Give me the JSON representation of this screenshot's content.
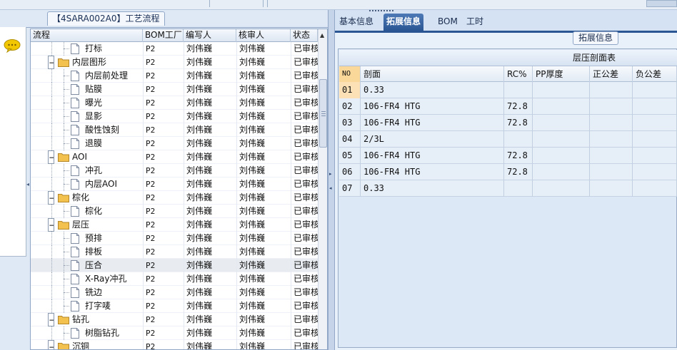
{
  "left": {
    "pane_title": "【4SARA002A0】工艺流程",
    "columns": [
      "流程",
      "BOM工厂",
      "编写人",
      "核审人",
      "状态"
    ],
    "rows": [
      {
        "name": "打标",
        "level": 2,
        "kind": "doc",
        "bom": "P2",
        "writer": "刘伟巍",
        "reviewer": "刘伟巍",
        "status": "已审核"
      },
      {
        "name": "内层图形",
        "level": 1,
        "kind": "folder",
        "bom": "P2",
        "writer": "刘伟巍",
        "reviewer": "刘伟巍",
        "status": "已审核"
      },
      {
        "name": "内层前处理",
        "level": 2,
        "kind": "doc",
        "bom": "P2",
        "writer": "刘伟巍",
        "reviewer": "刘伟巍",
        "status": "已审核"
      },
      {
        "name": "贴膜",
        "level": 2,
        "kind": "doc",
        "bom": "P2",
        "writer": "刘伟巍",
        "reviewer": "刘伟巍",
        "status": "已审核"
      },
      {
        "name": "曝光",
        "level": 2,
        "kind": "doc",
        "bom": "P2",
        "writer": "刘伟巍",
        "reviewer": "刘伟巍",
        "status": "已审核"
      },
      {
        "name": "显影",
        "level": 2,
        "kind": "doc",
        "bom": "P2",
        "writer": "刘伟巍",
        "reviewer": "刘伟巍",
        "status": "已审核"
      },
      {
        "name": "酸性蚀刻",
        "level": 2,
        "kind": "doc",
        "bom": "P2",
        "writer": "刘伟巍",
        "reviewer": "刘伟巍",
        "status": "已审核"
      },
      {
        "name": "退膜",
        "level": 2,
        "kind": "doc",
        "bom": "P2",
        "writer": "刘伟巍",
        "reviewer": "刘伟巍",
        "status": "已审核"
      },
      {
        "name": "AOI",
        "level": 1,
        "kind": "folder",
        "bom": "P2",
        "writer": "刘伟巍",
        "reviewer": "刘伟巍",
        "status": "已审核"
      },
      {
        "name": "冲孔",
        "level": 2,
        "kind": "doc",
        "bom": "P2",
        "writer": "刘伟巍",
        "reviewer": "刘伟巍",
        "status": "已审核"
      },
      {
        "name": "内层AOI",
        "level": 2,
        "kind": "doc",
        "bom": "P2",
        "writer": "刘伟巍",
        "reviewer": "刘伟巍",
        "status": "已审核"
      },
      {
        "name": "棕化",
        "level": 1,
        "kind": "folder",
        "bom": "P2",
        "writer": "刘伟巍",
        "reviewer": "刘伟巍",
        "status": "已审核"
      },
      {
        "name": "棕化",
        "level": 2,
        "kind": "doc",
        "bom": "P2",
        "writer": "刘伟巍",
        "reviewer": "刘伟巍",
        "status": "已审核"
      },
      {
        "name": "层压",
        "level": 1,
        "kind": "folder",
        "bom": "P2",
        "writer": "刘伟巍",
        "reviewer": "刘伟巍",
        "status": "已审核"
      },
      {
        "name": "预排",
        "level": 2,
        "kind": "doc",
        "bom": "P2",
        "writer": "刘伟巍",
        "reviewer": "刘伟巍",
        "status": "已审核"
      },
      {
        "name": "排板",
        "level": 2,
        "kind": "doc",
        "bom": "P2",
        "writer": "刘伟巍",
        "reviewer": "刘伟巍",
        "status": "已审核"
      },
      {
        "name": "压合",
        "level": 2,
        "kind": "doc",
        "bom": "P2",
        "writer": "刘伟巍",
        "reviewer": "刘伟巍",
        "status": "已审核",
        "selected": true
      },
      {
        "name": "X-Ray冲孔",
        "level": 2,
        "kind": "doc",
        "bom": "P2",
        "writer": "刘伟巍",
        "reviewer": "刘伟巍",
        "status": "已审核"
      },
      {
        "name": "铣边",
        "level": 2,
        "kind": "doc",
        "bom": "P2",
        "writer": "刘伟巍",
        "reviewer": "刘伟巍",
        "status": "已审核"
      },
      {
        "name": "打字唛",
        "level": 2,
        "kind": "doc",
        "bom": "P2",
        "writer": "刘伟巍",
        "reviewer": "刘伟巍",
        "status": "已审核"
      },
      {
        "name": "钻孔",
        "level": 1,
        "kind": "folder",
        "bom": "P2",
        "writer": "刘伟巍",
        "reviewer": "刘伟巍",
        "status": "已审核"
      },
      {
        "name": "树脂钻孔",
        "level": 2,
        "kind": "doc",
        "bom": "P2",
        "writer": "刘伟巍",
        "reviewer": "刘伟巍",
        "status": "已审核"
      },
      {
        "name": "沉铜",
        "level": 1,
        "kind": "folder",
        "bom": "P2",
        "writer": "刘伟巍",
        "reviewer": "刘伟巍",
        "status": "已审核"
      }
    ]
  },
  "right": {
    "tabs": [
      {
        "label": "基本信息",
        "active": false
      },
      {
        "label": "拓展信息",
        "active": true
      },
      {
        "label": "BOM",
        "active": false
      },
      {
        "label": "工时",
        "active": false
      }
    ],
    "section_title": "拓展信息",
    "table_caption": "层压剖面表",
    "columns": [
      "NO",
      "剖面",
      "RC%",
      "PP厚度",
      "正公差",
      "负公差"
    ],
    "rows": [
      {
        "no": "01",
        "profile": "0.33",
        "rc": "",
        "pp": "",
        "pos": "",
        "neg": ""
      },
      {
        "no": "02",
        "profile": "106-FR4 HTG",
        "rc": "72.8",
        "pp": "",
        "pos": "",
        "neg": ""
      },
      {
        "no": "03",
        "profile": "106-FR4 HTG",
        "rc": "72.8",
        "pp": "",
        "pos": "",
        "neg": ""
      },
      {
        "no": "04",
        "profile": "2/3L",
        "rc": "",
        "pp": "",
        "pos": "",
        "neg": ""
      },
      {
        "no": "05",
        "profile": "106-FR4 HTG",
        "rc": "72.8",
        "pp": "",
        "pos": "",
        "neg": ""
      },
      {
        "no": "06",
        "profile": "106-FR4 HTG",
        "rc": "72.8",
        "pp": "",
        "pos": "",
        "neg": ""
      },
      {
        "no": "07",
        "profile": "0.33",
        "rc": "",
        "pp": "",
        "pos": "",
        "neg": ""
      }
    ]
  },
  "colors": {
    "accent_tab": "#2a5694",
    "folder": "#f2c14e",
    "selected_row": "#e8ecf0",
    "no_header": "#f9d89a"
  }
}
